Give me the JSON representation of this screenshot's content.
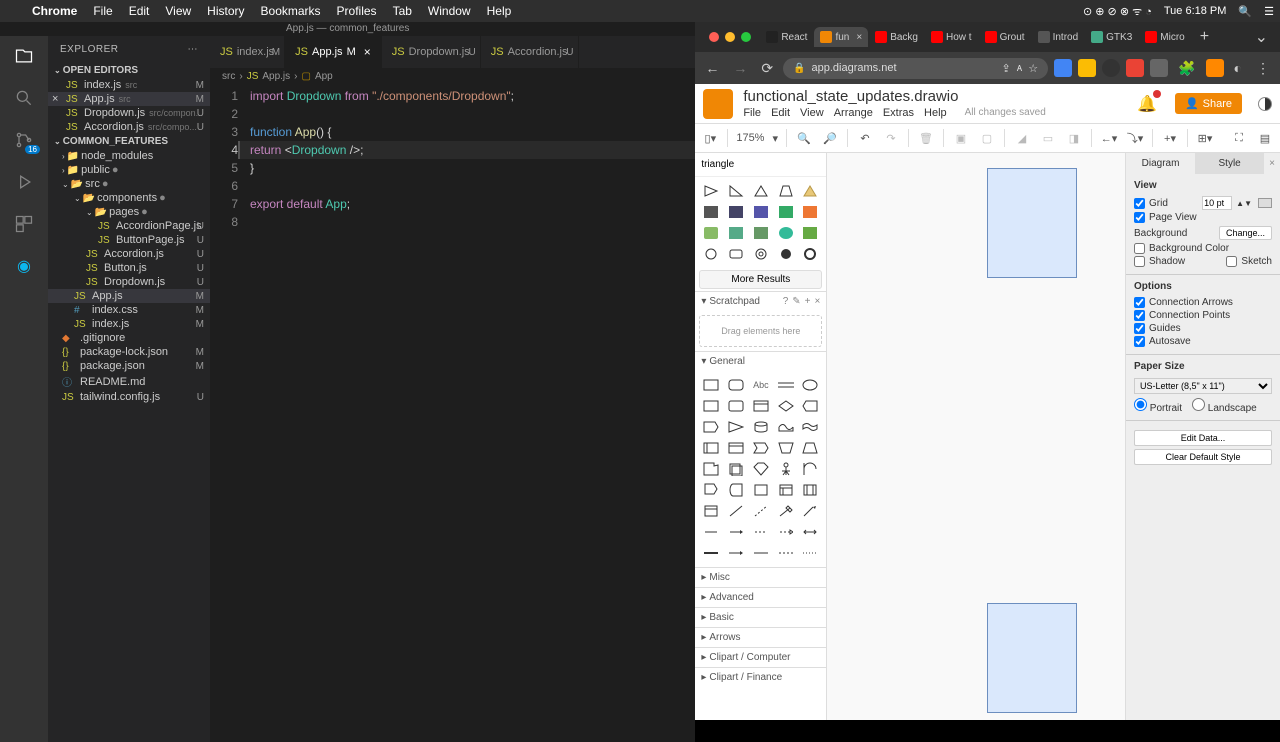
{
  "menubar": {
    "app": "Chrome",
    "items": [
      "File",
      "Edit",
      "View",
      "History",
      "Bookmarks",
      "Profiles",
      "Tab",
      "Window",
      "Help"
    ],
    "time": "Tue 6:18 PM"
  },
  "vscode": {
    "title": "App.js — common_features",
    "explorer": "EXPLORER",
    "open_editors": "OPEN EDITORS",
    "project": "COMMON_FEATURES",
    "editors": [
      {
        "name": "index.js",
        "hint": "src",
        "status": "M"
      },
      {
        "name": "App.js",
        "hint": "src",
        "status": "M",
        "dirty": true
      },
      {
        "name": "Dropdown.js",
        "hint": "src/compon...",
        "status": "U"
      },
      {
        "name": "Accordion.js",
        "hint": "src/compo...",
        "status": "U"
      }
    ],
    "tree": {
      "node_modules": "node_modules",
      "public": "public",
      "src": "src",
      "components": "components",
      "pages": "pages",
      "files": [
        {
          "name": "AccordionPage.js",
          "status": "U"
        },
        {
          "name": "ButtonPage.js",
          "status": "U"
        },
        {
          "name": "Accordion.js",
          "status": "U"
        },
        {
          "name": "Button.js",
          "status": "U"
        },
        {
          "name": "Dropdown.js",
          "status": "U"
        },
        {
          "name": "App.js",
          "status": "M",
          "selected": true
        },
        {
          "name": "index.css",
          "status": "M"
        },
        {
          "name": "index.js",
          "status": "M"
        }
      ],
      "root_files": [
        {
          "name": ".gitignore",
          "status": ""
        },
        {
          "name": "package-lock.json",
          "status": "M"
        },
        {
          "name": "package.json",
          "status": "M"
        },
        {
          "name": "README.md",
          "status": ""
        },
        {
          "name": "tailwind.config.js",
          "status": "U"
        }
      ]
    },
    "tabs": [
      {
        "label": "index.js",
        "status": "M"
      },
      {
        "label": "App.js",
        "status": "M",
        "active": true,
        "dirty": true
      },
      {
        "label": "Dropdown.js",
        "status": "U"
      },
      {
        "label": "Accordion.js",
        "status": "U"
      }
    ],
    "breadcrumbs": [
      "src",
      "App.js",
      "App"
    ],
    "code": {
      "l1": {
        "import": "import ",
        "name": "Dropdown",
        "from": " from ",
        "path": "\"./components/Dropdown\"",
        "semi": ";"
      },
      "l3": {
        "fn": "function ",
        "name": "App",
        "paren": "() {"
      },
      "l4": {
        "ret": "return ",
        "open": "<",
        "comp": "Dropdown",
        "close": " />;"
      },
      "l5": "}",
      "l7": {
        "exp": "export default ",
        "name": "App",
        "semi": ";"
      }
    },
    "scm_badge": "16"
  },
  "chrome": {
    "tabs": [
      {
        "label": "React",
        "color": "#61dafb"
      },
      {
        "label": "fun",
        "color": "#f08705",
        "active": true
      },
      {
        "label": "Backg",
        "color": "#ff0000"
      },
      {
        "label": "How t",
        "color": "#ff0000"
      },
      {
        "label": "Grout",
        "color": "#ff0000"
      },
      {
        "label": "Introd",
        "color": "#555"
      },
      {
        "label": "GTK3",
        "color": "#4a8"
      },
      {
        "label": "Micro",
        "color": "#ff0000"
      }
    ],
    "url": "app.diagrams.net"
  },
  "drawio": {
    "filename": "functional_state_updates.drawio",
    "menus": [
      "File",
      "Edit",
      "View",
      "Arrange",
      "Extras",
      "Help"
    ],
    "saved": "All changes saved",
    "share": "Share",
    "zoom": "175%",
    "search": "triangle",
    "more_results": "More Results",
    "scratchpad": "Scratchpad",
    "drag_hint": "Drag elements here",
    "sections": {
      "general": "General",
      "misc": "Misc",
      "advanced": "Advanced",
      "basic": "Basic",
      "arrows": "Arrows",
      "clipart": "Clipart / Computer",
      "clipart2": "Clipart / Finance"
    },
    "format": {
      "tabs": {
        "diagram": "Diagram",
        "style": "Style"
      },
      "view": "View",
      "grid": "Grid",
      "grid_val": "10 pt",
      "page_view": "Page View",
      "background": "Background",
      "change": "Change...",
      "background_color": "Background Color",
      "shadow": "Shadow",
      "sketch": "Sketch",
      "options": "Options",
      "conn_arrows": "Connection Arrows",
      "conn_points": "Connection Points",
      "guides": "Guides",
      "autosave": "Autosave",
      "paper_size": "Paper Size",
      "paper_val": "US-Letter (8,5\" x 11\")",
      "portrait": "Portrait",
      "landscape": "Landscape",
      "edit_data": "Edit Data...",
      "clear_style": "Clear Default Style"
    }
  }
}
